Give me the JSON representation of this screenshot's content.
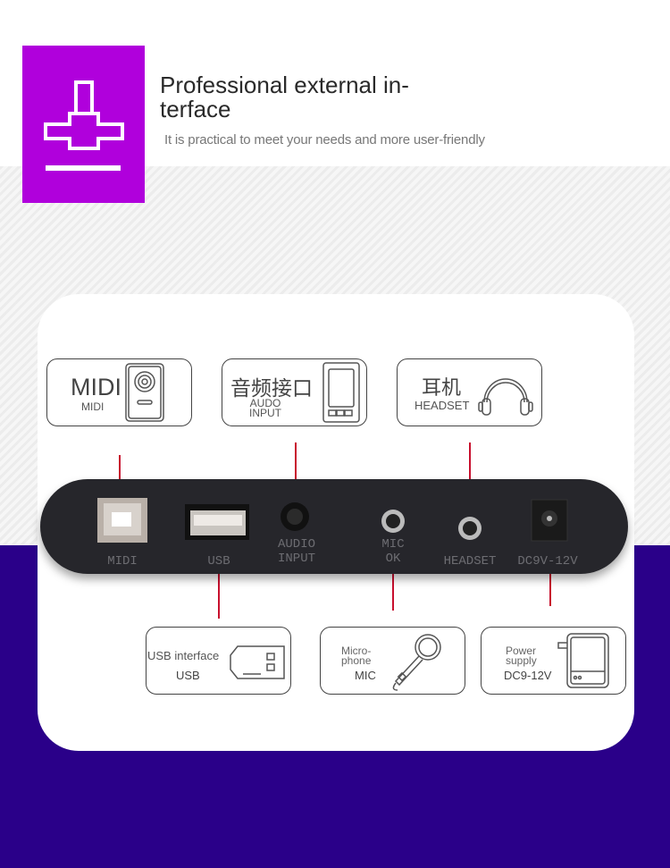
{
  "header": {
    "title": "Professional external in-terface",
    "title_line1": "Professional external in-",
    "title_line2": "terface",
    "subtitle": "It is practical to meet your needs and more user-friendly",
    "badge_icon": "interface-connector-icon"
  },
  "colors": {
    "badge": "#b000dc",
    "bottom_band": "#2a0089",
    "leader_lines": "#c8102e",
    "device": "#26262b"
  },
  "top_labels": [
    {
      "big": "MIDI",
      "small": "MIDI",
      "icon": "midi-port-icon"
    },
    {
      "big": "音频接口",
      "small_line1": "AUDO",
      "small_line2": "INPUT",
      "icon": "audio-device-icon"
    },
    {
      "big": "耳机",
      "small": "HEADSET",
      "icon": "headphones-icon"
    }
  ],
  "bottom_labels": [
    {
      "label": "USB interface",
      "code": "USB",
      "icon": "usb-plug-icon"
    },
    {
      "meta_line1": "Micro-",
      "meta_line2": "phone",
      "code": "MIC",
      "icon": "microphone-icon"
    },
    {
      "meta_line1": "Power",
      "meta_line2": "supply",
      "code": "DC9-12V",
      "icon": "power-adapter-icon"
    }
  ],
  "device_ports": [
    {
      "line1": "MIDI",
      "line2": ""
    },
    {
      "line1": "USB",
      "line2": ""
    },
    {
      "line1": "AUDIO",
      "line2": "INPUT"
    },
    {
      "line1": "MIC",
      "line2": "OK"
    },
    {
      "line1": "HEADSET",
      "line2": ""
    },
    {
      "line1": "DC9V-12V",
      "line2": ""
    }
  ]
}
